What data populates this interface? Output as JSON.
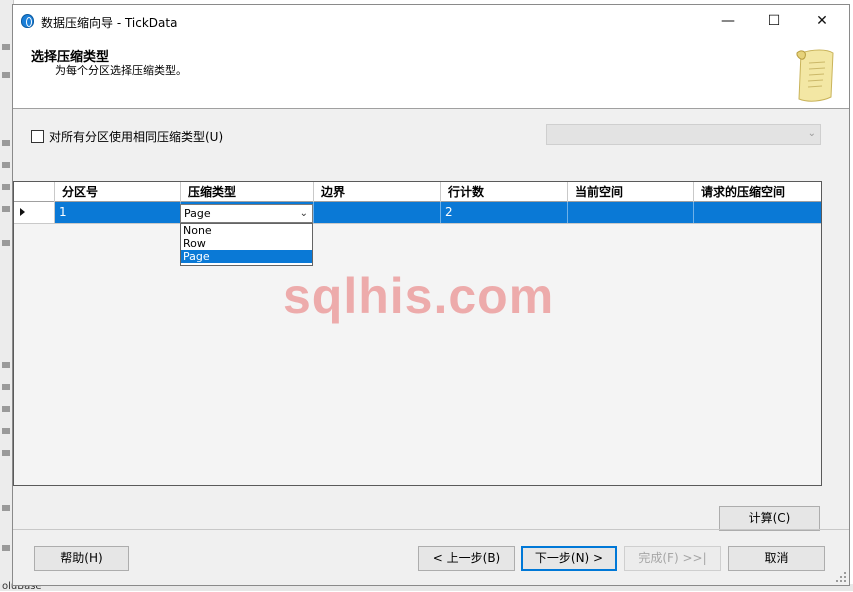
{
  "window": {
    "title": "数据压缩向导 - TickData",
    "minimize": "—",
    "maximize": "☐",
    "close": "✕"
  },
  "header": {
    "title": "选择压缩类型",
    "subtitle": "为每个分区选择压缩类型。"
  },
  "options": {
    "same_type_label": "对所有分区使用相同压缩类型(U)",
    "same_type_checked": false,
    "global_type_value": ""
  },
  "grid": {
    "columns": [
      "分区号",
      "压缩类型",
      "边界",
      "行计数",
      "当前空间",
      "请求的压缩空间"
    ],
    "rows": [
      {
        "partition": "1",
        "compression": "Page",
        "boundary": "",
        "row_count": "2",
        "current_space": "",
        "requested_space": ""
      }
    ],
    "dropdown_options": [
      "None",
      "Row",
      "Page"
    ],
    "dropdown_selected": "Page"
  },
  "watermark": "sqlhis.com",
  "buttons": {
    "calculate": "计算(C)",
    "help": "帮助(H)",
    "back": "< 上一步(B)",
    "next": "下一步(N) >",
    "finish": "完成(F) >>|",
    "cancel": "取消"
  },
  "background": {
    "bottom_text": "oluBase"
  },
  "colors": {
    "selection": "#0a79d6",
    "default_button_border": "#0078d7",
    "watermark": "#e87070"
  }
}
